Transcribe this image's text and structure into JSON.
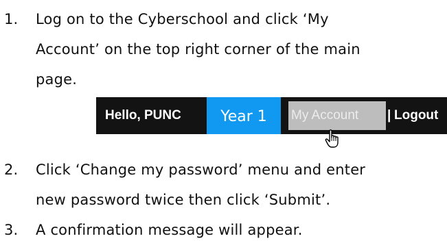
{
  "steps": [
    {
      "number": "1.",
      "lines": [
        "Log on to the Cyberschool and click ‘My",
        "Account’ on the top right corner of the main",
        "page."
      ]
    },
    {
      "number": "2.",
      "lines": [
        "Click ‘Change my password’ menu and enter",
        "new password twice then click ‘Submit’."
      ]
    },
    {
      "number": "3.",
      "lines": [
        "A confirmation message will appear."
      ]
    }
  ],
  "navbar": {
    "greeting": "Hello, PUNC",
    "year_tab": "Year 1",
    "my_account": "My Account",
    "separator": "|",
    "logout": "Logout"
  },
  "colors": {
    "navbar_background": "#131313",
    "year_tab_background": "#1199f2",
    "my_account_highlight": "#bdbdbd"
  },
  "icons": {
    "cursor": "pointing-hand-cursor-icon"
  }
}
